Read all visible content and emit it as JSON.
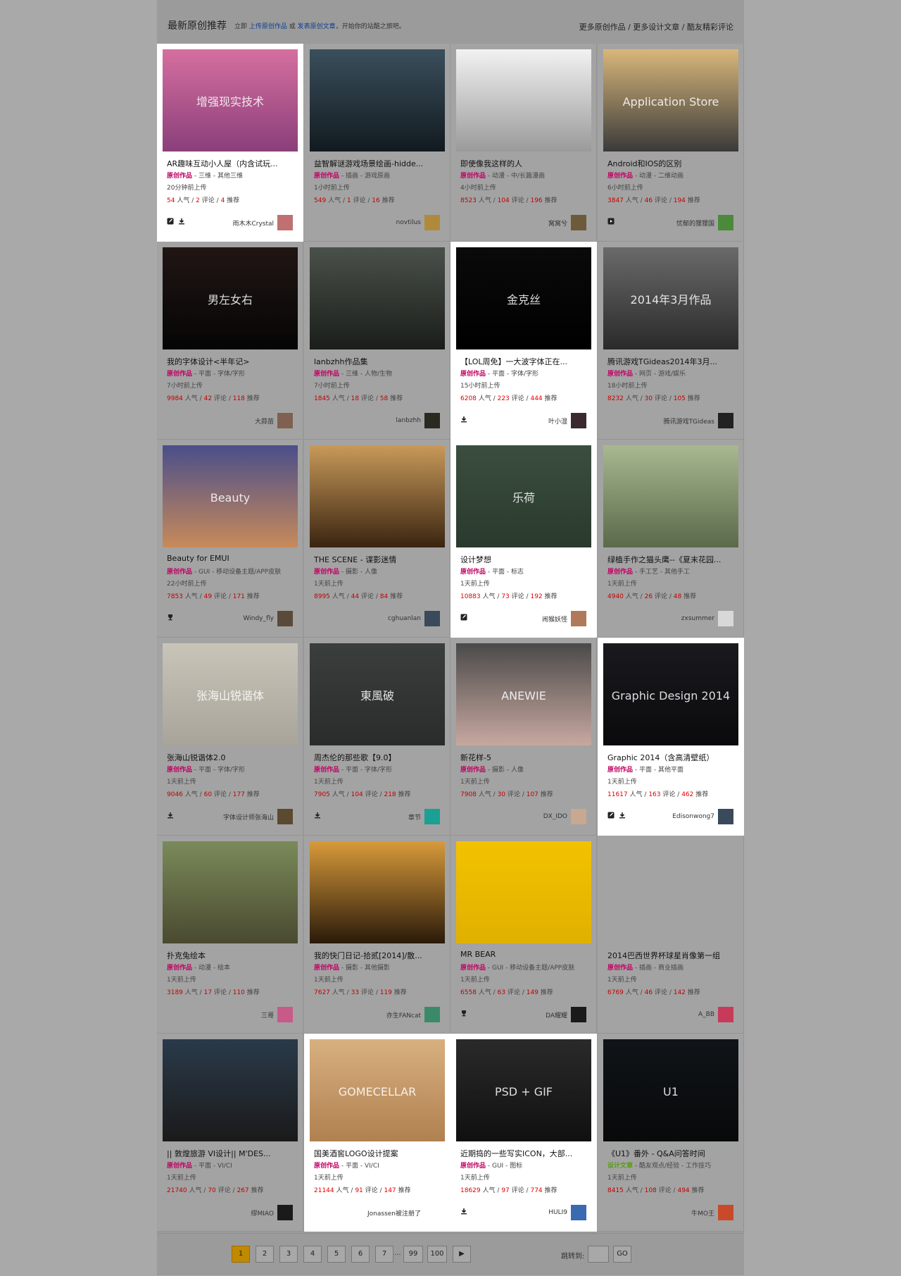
{
  "header": {
    "title": "最新原创推荐",
    "sub_prefix": "立即",
    "upload_link": "上传原创作品",
    "or_text": "或",
    "publish_link": "发表原创文章",
    "sub_suffix": "，开始你的站酷之旅吧。",
    "more_works": "更多原创作品",
    "more_articles": "更多设计文章",
    "more_comments": "酷友精彩评论",
    "sep": " / "
  },
  "labels": {
    "popularity": "人气",
    "comments": "评论",
    "recommend": "推荐",
    "sep": "/",
    "dash": " - "
  },
  "cards": [
    {
      "title": "AR趣味互动小人屋（内含试玩...",
      "type": "原创作品",
      "category": "三维 - 其他三维",
      "time": "20分钟前上传",
      "views": "54",
      "comments": "2",
      "recs": "4",
      "user": "雨木木Crystal",
      "highlight": true,
      "icons": [
        "edit-icon",
        "download-icon"
      ],
      "thumb_colors": [
        "#d66fa0",
        "#8a3f7a"
      ],
      "thumb_text": "增强现实技术",
      "avatar_color": "#c07070"
    },
    {
      "title": "益智解谜游戏场景绘画-hidde...",
      "type": "原创作品",
      "category": "插画 - 游戏原画",
      "time": "1小时前上传",
      "views": "549",
      "comments": "1",
      "recs": "16",
      "user": "novtilus",
      "highlight": false,
      "icons": [],
      "thumb_colors": [
        "#3a4f5c",
        "#121a20"
      ],
      "thumb_text": "",
      "avatar_color": "#b08a3c"
    },
    {
      "title": "即使像我这样的人",
      "type": "原创作品",
      "category": "动漫 - 中/长篇漫画",
      "time": "4小时前上传",
      "views": "8523",
      "comments": "104",
      "recs": "196",
      "user": "窝窝兮",
      "highlight": false,
      "icons": [],
      "thumb_colors": [
        "#f2f2f2",
        "#9a9a9a"
      ],
      "thumb_text": "",
      "avatar_color": "#6c5a3a"
    },
    {
      "title": "Android和IOS的区别",
      "type": "原创作品",
      "category": "动漫 - 二维动画",
      "time": "6小时前上传",
      "views": "3847",
      "comments": "46",
      "recs": "194",
      "user": "忧郁的狸狸国",
      "highlight": false,
      "icons": [
        "play-icon"
      ],
      "thumb_colors": [
        "#d9b77a",
        "#3a3a3a"
      ],
      "thumb_text": "Application Store",
      "avatar_color": "#4a8a3a"
    },
    {
      "title": "我的字体设计<半年记>",
      "type": "原创作品",
      "category": "平面 - 字体/字形",
      "time": "7小时前上传",
      "views": "9984",
      "comments": "42",
      "recs": "118",
      "user": "大蒜苗",
      "highlight": false,
      "icons": [],
      "thumb_colors": [
        "#201614",
        "#050505"
      ],
      "thumb_text": "男左女右",
      "avatar_color": "#806050"
    },
    {
      "title": "lanbzhh作品集",
      "type": "原创作品",
      "category": "三维 - 人物/生物",
      "time": "7小时前上传",
      "views": "1845",
      "comments": "18",
      "recs": "58",
      "user": "lanbzhh",
      "highlight": false,
      "icons": [],
      "thumb_colors": [
        "#4a504a",
        "#1a1e1a"
      ],
      "thumb_text": "",
      "avatar_color": "#2a2a20"
    },
    {
      "title": "【LOL周免】一大波字体正在...",
      "type": "原创作品",
      "category": "平面 - 字体/字形",
      "time": "15小时前上传",
      "views": "6208",
      "comments": "223",
      "recs": "444",
      "user": "叶小湿",
      "highlight": true,
      "icons": [
        "download-icon"
      ],
      "thumb_colors": [
        "#0a0a0a",
        "#000000"
      ],
      "thumb_text": "金克丝",
      "avatar_color": "#3a2a30"
    },
    {
      "title": "腾讯游戏TGideas2014年3月...",
      "type": "原创作品",
      "category": "网页 - 游戏/娱乐",
      "time": "18小时前上传",
      "views": "8232",
      "comments": "30",
      "recs": "105",
      "user": "腾讯游戏TGideas",
      "highlight": false,
      "icons": [],
      "thumb_colors": [
        "#6a6a6a",
        "#2a2a2a"
      ],
      "thumb_text": "2014年3月作品",
      "avatar_color": "#222222"
    },
    {
      "title": "Beauty for EMUI",
      "type": "原创作品",
      "category": "GUI - 移动设备主题/APP皮肤",
      "time": "22小时前上传",
      "views": "7853",
      "comments": "49",
      "recs": "171",
      "user": "Windy_fly",
      "highlight": false,
      "icons": [
        "trophy-icon"
      ],
      "thumb_colors": [
        "#4a4e8a",
        "#c88a5a"
      ],
      "thumb_text": "Beauty",
      "avatar_color": "#5a4a3a"
    },
    {
      "title": "THE SCENE - 谍影迷情",
      "type": "原创作品",
      "category": "摄影 - 人像",
      "time": "1天前上传",
      "views": "8995",
      "comments": "44",
      "recs": "84",
      "user": "cghuanlan",
      "highlight": false,
      "icons": [],
      "thumb_colors": [
        "#c89a5a",
        "#3a2410"
      ],
      "thumb_text": "",
      "avatar_color": "#3a4a5a"
    },
    {
      "title": "设计梦想",
      "type": "原创作品",
      "category": "平面 - 标志",
      "time": "1天前上传",
      "views": "10883",
      "comments": "73",
      "recs": "192",
      "user": "闹猴妖怪",
      "highlight": true,
      "icons": [
        "edit-icon"
      ],
      "thumb_colors": [
        "#3a4e3e",
        "#2a3a2e"
      ],
      "thumb_text": "乐荷",
      "avatar_color": "#b07a5a"
    },
    {
      "title": "绿植手作之猫头鹰--《夏末花园...",
      "type": "原创作品",
      "category": "手工艺 - 其他手工",
      "time": "1天前上传",
      "views": "4940",
      "comments": "26",
      "recs": "48",
      "user": "zxsummer",
      "highlight": false,
      "icons": [],
      "thumb_colors": [
        "#a8b890",
        "#5a6a4a"
      ],
      "thumb_text": "",
      "avatar_color": "#d8d8d8"
    },
    {
      "title": "张海山锐谐体2.0",
      "type": "原创作品",
      "category": "平面 - 字体/字形",
      "time": "1天前上传",
      "views": "9046",
      "comments": "60",
      "recs": "177",
      "user": "字体设计师张海山",
      "highlight": false,
      "icons": [
        "download-icon"
      ],
      "thumb_colors": [
        "#c8c4b8",
        "#a8a49a"
      ],
      "thumb_text": "张海山锐谐体",
      "avatar_color": "#5a4a30"
    },
    {
      "title": "周杰伦的那些歌【9.0】",
      "type": "原创作品",
      "category": "平面 - 字体/字形",
      "time": "1天前上传",
      "views": "7905",
      "comments": "104",
      "recs": "218",
      "user": "章节",
      "highlight": false,
      "icons": [
        "download-icon"
      ],
      "thumb_colors": [
        "#3a3e3c",
        "#2a2c2c"
      ],
      "thumb_text": "東風破",
      "avatar_color": "#1aa094"
    },
    {
      "title": "新花样-5",
      "type": "原创作品",
      "category": "摄影 - 人像",
      "time": "1天前上传",
      "views": "7908",
      "comments": "30",
      "recs": "107",
      "user": "DX_IDO",
      "highlight": false,
      "icons": [],
      "thumb_colors": [
        "#4a4a4a",
        "#c8a8a0"
      ],
      "thumb_text": "ANEWIE",
      "avatar_color": "#c8a890"
    },
    {
      "title": "Graphic 2014（含高清壁纸）",
      "type": "原创作品",
      "category": "平面 - 其他平面",
      "time": "1天前上传",
      "views": "11617",
      "comments": "163",
      "recs": "462",
      "user": "Edisonwong7",
      "highlight": true,
      "icons": [
        "edit-icon",
        "download-icon"
      ],
      "thumb_colors": [
        "#1a1a1e",
        "#0a0a0c"
      ],
      "thumb_text": "Graphic Design 2014",
      "avatar_color": "#3a4a5a"
    },
    {
      "title": "扑克兔绘本",
      "type": "原创作品",
      "category": "动漫 - 绘本",
      "time": "1天前上传",
      "views": "3189",
      "comments": "17",
      "recs": "110",
      "user": "三哥",
      "highlight": false,
      "icons": [],
      "thumb_colors": [
        "#7a8a5a",
        "#4a4a30"
      ],
      "thumb_text": "",
      "avatar_color": "#c85a8a"
    },
    {
      "title": "我的快门日记-拾贰[2014]/散...",
      "type": "原创作品",
      "category": "摄影 - 其他摄影",
      "time": "1天前上传",
      "views": "7627",
      "comments": "33",
      "recs": "119",
      "user": "亦生FANcat",
      "highlight": false,
      "icons": [],
      "thumb_colors": [
        "#d89a3a",
        "#2a1a0a"
      ],
      "thumb_text": "",
      "avatar_color": "#3a8a6a"
    },
    {
      "title": "MR BEAR",
      "type": "原创作品",
      "category": "GUI - 移动设备主题/APP皮肤",
      "time": "1天前上传",
      "views": "6558",
      "comments": "63",
      "recs": "149",
      "user": "DA耀耀",
      "highlight": false,
      "icons": [
        "trophy-icon"
      ],
      "thumb_colors": [
        "#f2c200",
        "#e0b000"
      ],
      "thumb_text": "",
      "avatar_color": "#1a1a1a"
    },
    {
      "title": "2014巴西世界杯球星肖像第一组",
      "type": "原创作品",
      "category": "插画 - 商业插画",
      "time": "1天前上传",
      "views": "6769",
      "comments": "46",
      "recs": "142",
      "user": "A_BB",
      "highlight": false,
      "icons": [],
      "thumb_colors": [
        "#a3a3a3",
        "#a3a3a3"
      ],
      "thumb_text": "",
      "avatar_color": "#c83a5a"
    },
    {
      "title": "|| 敦煌旅游 VI设计|| M'DES...",
      "type": "原创作品",
      "category": "平面 - VI/CI",
      "time": "1天前上传",
      "views": "21740",
      "comments": "70",
      "recs": "267",
      "user": "缪MIAO",
      "highlight": false,
      "icons": [],
      "thumb_colors": [
        "#2a3a4a",
        "#1a1a1a"
      ],
      "thumb_text": "",
      "avatar_color": "#1a1a1a"
    },
    {
      "title": "国美酒窖LOGO设计提案",
      "type": "原创作品",
      "category": "平面 - VI/CI",
      "time": "1天前上传",
      "views": "21144",
      "comments": "91",
      "recs": "147",
      "user": "Jonassen被注册了",
      "highlight": true,
      "icons": [],
      "thumb_colors": [
        "#d8b080",
        "#b08050"
      ],
      "thumb_text": "GOMECELLAR",
      "avatar_color": "#ffffff"
    },
    {
      "title": "近期捣的一些写实ICON，大部...",
      "type": "原创作品",
      "category": "GUI - 图标",
      "time": "1天前上传",
      "views": "18629",
      "comments": "97",
      "recs": "774",
      "user": "HULI9",
      "highlight": true,
      "icons": [
        "download-icon"
      ],
      "thumb_colors": [
        "#2a2a2a",
        "#101010"
      ],
      "thumb_text": "PSD + GIF",
      "avatar_color": "#3a6ab0"
    },
    {
      "title": "《U1》番外 - Q&A问答时间",
      "type": "设计文章",
      "category": "酷友观点/经验 - 工作技巧",
      "time": "1天前上传",
      "views": "8415",
      "comments": "108",
      "recs": "494",
      "user": "牛MO王",
      "highlight": false,
      "icons": [],
      "thumb_colors": [
        "#101418",
        "#08090a"
      ],
      "thumb_text": "U1",
      "avatar_color": "#c84a2a"
    }
  ],
  "pagination": {
    "pages": [
      "1",
      "2",
      "3",
      "4",
      "5",
      "6",
      "7",
      "99",
      "100"
    ],
    "ellipsis": "...",
    "current": "1",
    "next": "▶",
    "jump_label": "跳转到:",
    "jump_value": "",
    "go_label": "GO"
  }
}
